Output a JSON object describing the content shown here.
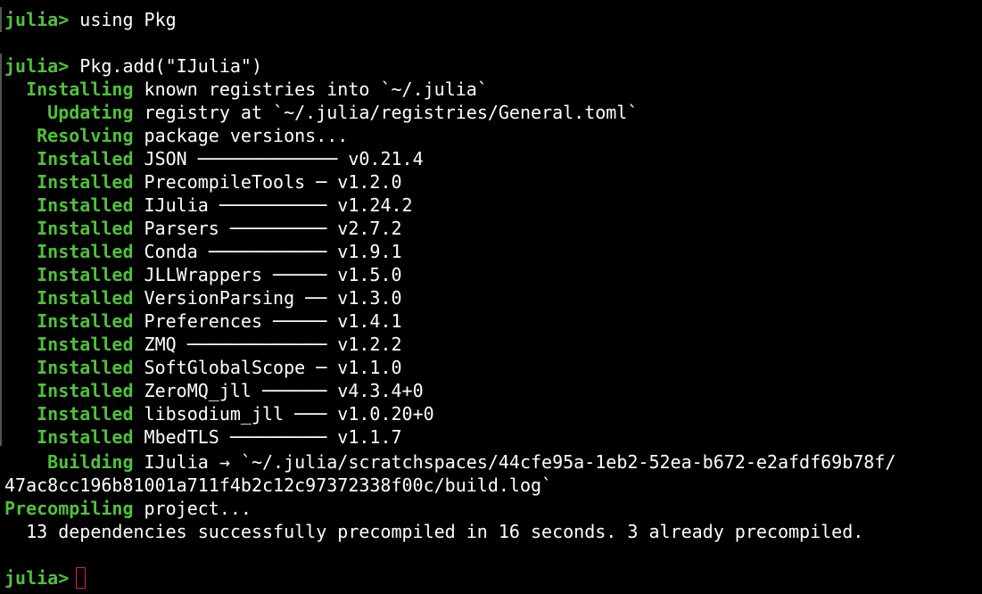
{
  "colors": {
    "background": "#000000",
    "prompt_green": "#4fc23a",
    "text": "#ffffff",
    "cursor_outline": "#d0245a"
  },
  "lines": [
    {
      "prefix": "julia>",
      "text": " using Pkg"
    },
    {
      "prefix": "julia>",
      "text": " Pkg.add(\"IJulia\")"
    },
    {
      "prefix": "  Installing",
      "text": " known registries into `~/.julia`"
    },
    {
      "prefix": "    Updating",
      "text": " registry at `~/.julia/registries/General.toml`"
    },
    {
      "prefix": "   Resolving",
      "text": " package versions..."
    },
    {
      "prefix": "   Installed",
      "text": " JSON ───────────── v0.21.4"
    },
    {
      "prefix": "   Installed",
      "text": " PrecompileTools ─ v1.2.0"
    },
    {
      "prefix": "   Installed",
      "text": " IJulia ────────── v1.24.2"
    },
    {
      "prefix": "   Installed",
      "text": " Parsers ───────── v2.7.2"
    },
    {
      "prefix": "   Installed",
      "text": " Conda ─────────── v1.9.1"
    },
    {
      "prefix": "   Installed",
      "text": " JLLWrappers ───── v1.5.0"
    },
    {
      "prefix": "   Installed",
      "text": " VersionParsing ── v1.3.0"
    },
    {
      "prefix": "   Installed",
      "text": " Preferences ───── v1.4.1"
    },
    {
      "prefix": "   Installed",
      "text": " ZMQ ───────────── v1.2.2"
    },
    {
      "prefix": "   Installed",
      "text": " SoftGlobalScope ─ v1.1.0"
    },
    {
      "prefix": "   Installed",
      "text": " ZeroMQ_jll ────── v4.3.4+0"
    },
    {
      "prefix": "   Installed",
      "text": " libsodium_jll ─── v1.0.20+0"
    },
    {
      "prefix": "   Installed",
      "text": " MbedTLS ───────── v1.1.7"
    },
    {
      "prefix": "    Building",
      "text": " IJulia → `~/.julia/scratchspaces/44cfe95a-1eb2-52ea-b672-e2afdf69b78f/"
    },
    {
      "prefix": "",
      "text": "47ac8cc196b81001a711f4b2c12c97372338f00c/build.log`"
    },
    {
      "prefix": "Precompiling",
      "text": " project..."
    },
    {
      "prefix": "",
      "text": "  13 dependencies successfully precompiled in 16 seconds. 3 already precompiled."
    },
    {
      "prefix": "julia>",
      "text": " "
    }
  ]
}
